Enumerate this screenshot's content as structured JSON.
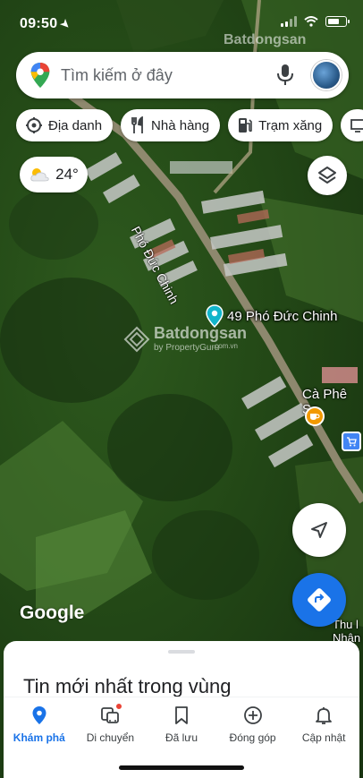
{
  "status_bar": {
    "time": "09:50"
  },
  "search": {
    "placeholder": "Tìm kiếm ở đây"
  },
  "chips": [
    {
      "label": "Địa danh",
      "icon": "landmark-icon"
    },
    {
      "label": "Nhà hàng",
      "icon": "restaurant-icon"
    },
    {
      "label": "Trạm xăng",
      "icon": "gas-station-icon"
    }
  ],
  "weather": {
    "temperature": "24°",
    "icon": "partly-cloudy-icon"
  },
  "map": {
    "street_label": "Phó Đức Chinh",
    "place_label": "49 Phó Đức Chinh",
    "cafe_label": "Cà Phê Sạ",
    "poi_label_line1": "Thu l",
    "poi_label_line2": "Nhân l",
    "watermark_brand": "Batdongsan",
    "watermark_sub": "by PropertyGuru",
    "watermark_domain": ".com.vn",
    "attribution": "Google"
  },
  "bottom_sheet": {
    "title": "Tin mới nhất trong vùng"
  },
  "nav": [
    {
      "label": "Khám phá",
      "icon": "explore-pin-icon",
      "active": true
    },
    {
      "label": "Di chuyển",
      "icon": "commute-icon",
      "active": false
    },
    {
      "label": "Đã lưu",
      "icon": "bookmark-icon",
      "active": false
    },
    {
      "label": "Đóng góp",
      "icon": "add-circle-icon",
      "active": false
    },
    {
      "label": "Cập nhật",
      "icon": "bell-icon",
      "active": false
    }
  ],
  "colors": {
    "accent": "#1a73e8",
    "pin": "#12b5cb",
    "cafe": "#f29900",
    "badge": "#ea4335"
  }
}
